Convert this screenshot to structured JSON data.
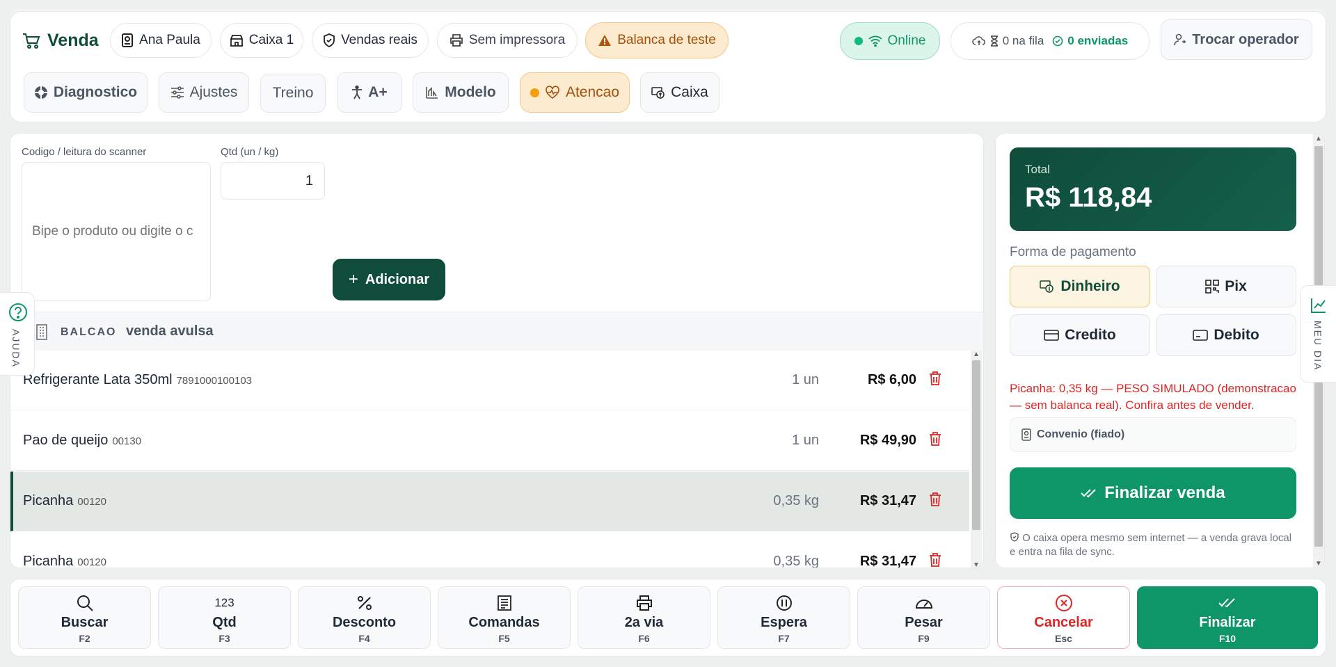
{
  "header": {
    "title": "Venda",
    "operator": "Ana Paula",
    "register": "Caixa 1",
    "sales_mode": "Vendas reais",
    "printer": "Sem impressora",
    "scale": "Balanca de teste",
    "online": "Online",
    "queue": "0 na fila",
    "sent": "0 enviadas",
    "switch_operator": "Trocar operador"
  },
  "toolbar": {
    "diagnostico": "Diagnostico",
    "ajustes": "Ajustes",
    "treino": "Treino",
    "accessibility": "A+",
    "modelo": "Modelo",
    "atencao": "Atencao",
    "caixa": "Caixa"
  },
  "entry": {
    "code_label": "Codigo / leitura do scanner",
    "code_placeholder": "Bipe o produto ou digite o c",
    "qty_label": "Qtd (un / kg)",
    "qty_value": "1",
    "add_label": "Adicionar"
  },
  "customer": {
    "tag": "BALCAO",
    "name": "venda avulsa"
  },
  "items": [
    {
      "name": "Refrigerante Lata 350ml",
      "code": "7891000100103",
      "qty": "1 un",
      "price": "R$ 6,00"
    },
    {
      "name": "Pao de queijo",
      "code": "00130",
      "qty": "1 un",
      "price": "R$ 49,90"
    },
    {
      "name": "Picanha",
      "code": "00120",
      "qty": "0,35 kg",
      "price": "R$ 31,47"
    },
    {
      "name": "Picanha",
      "code": "00120",
      "qty": "0,35 kg",
      "price": "R$ 31,47"
    }
  ],
  "summary": {
    "total_label": "Total",
    "total_value": "R$ 118,84",
    "payment_label": "Forma de pagamento",
    "methods": [
      "Dinheiro",
      "Pix",
      "Credito",
      "Debito"
    ],
    "warning": "Picanha: 0,35 kg — PESO SIMULADO (demonstracao — sem balanca real). Confira antes de vender.",
    "convenio": "Convenio (fiado)",
    "finalize": "Finalizar venda",
    "offline_note": "O caixa opera mesmo sem internet — a venda grava local e entra na fila de sync."
  },
  "side": {
    "help": "AJUDA",
    "my_day": "MEU DIA"
  },
  "fkeys": [
    {
      "label": "Buscar",
      "key": "F2"
    },
    {
      "label": "Qtd",
      "key": "F3",
      "icon_text": "123"
    },
    {
      "label": "Desconto",
      "key": "F4"
    },
    {
      "label": "Comandas",
      "key": "F5"
    },
    {
      "label": "2a via",
      "key": "F6"
    },
    {
      "label": "Espera",
      "key": "F7"
    },
    {
      "label": "Pesar",
      "key": "F9"
    },
    {
      "label": "Cancelar",
      "key": "Esc"
    },
    {
      "label": "Finalizar",
      "key": "F10"
    }
  ],
  "colors": {
    "brand": "#0f9668",
    "brand_dark": "#0f4c3a",
    "danger": "#dc2626",
    "warning_bg": "#fdebd0"
  }
}
